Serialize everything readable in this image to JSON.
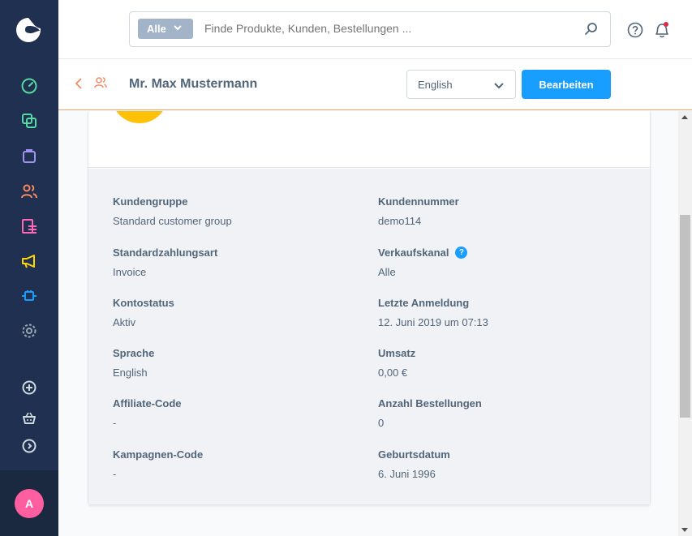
{
  "search": {
    "type_label": "Alle",
    "placeholder": "Finde Produkte, Kunden, Bestellungen ..."
  },
  "smartbar": {
    "title": "Mr. Max Mustermann",
    "language": "English",
    "edit_label": "Bearbeiten"
  },
  "sidebar": {
    "items": [
      {
        "icon": "dashboard-icon",
        "color": "#57d9a3"
      },
      {
        "icon": "catalog-icon",
        "color": "#57d9a3"
      },
      {
        "icon": "orders-icon",
        "color": "#a092f0"
      },
      {
        "icon": "customers-icon",
        "color": "#f88962"
      },
      {
        "icon": "content-icon",
        "color": "#ff68b4"
      },
      {
        "icon": "marketing-icon",
        "color": "#ffd700"
      },
      {
        "icon": "extensions-icon",
        "color": "#189eff"
      },
      {
        "icon": "settings-icon",
        "color": "#9aa8b5"
      }
    ],
    "avatar_initial": "A"
  },
  "details": {
    "left": [
      {
        "label": "Kundengruppe",
        "value": "Standard customer group"
      },
      {
        "label": "Standardzahlungsart",
        "value": "Invoice"
      },
      {
        "label": "Kontostatus",
        "value": "Aktiv"
      },
      {
        "label": "Sprache",
        "value": "English"
      },
      {
        "label": "Affiliate-Code",
        "value": "-"
      },
      {
        "label": "Kampagnen-Code",
        "value": "-"
      }
    ],
    "right": [
      {
        "label": "Kundennummer",
        "value": "demo114"
      },
      {
        "label": "Verkaufskanal",
        "value": "Alle",
        "info": "?"
      },
      {
        "label": "Letzte Anmeldung",
        "value": "12. Juni 2019 um 07:13"
      },
      {
        "label": "Umsatz",
        "value": "0,00 €"
      },
      {
        "label": "Anzahl Bestellungen",
        "value": "0"
      },
      {
        "label": "Geburtsdatum",
        "value": "6. Juni 1996"
      }
    ]
  },
  "colors": {
    "sidebar_bg": "#1f3050",
    "primary": "#189eff",
    "avatar_bg": "#ff5fa1",
    "customer_avatar": "#ffc107",
    "smartbar_accent": "#f0a36f"
  }
}
